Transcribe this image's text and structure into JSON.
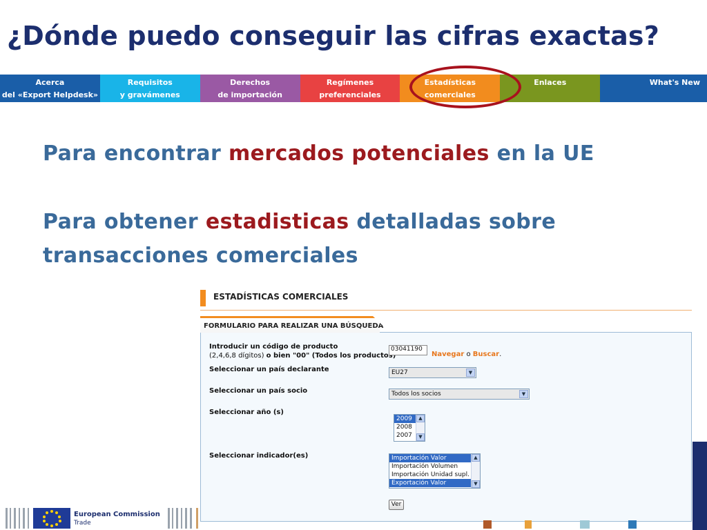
{
  "slide": {
    "title": "¿Dónde puedo conseguir las cifras exactas?",
    "bullet1": {
      "pre": "Para encontrar ",
      "highlight": "mercados potenciales",
      "post": " en la UE"
    },
    "bullet2": {
      "pre": "Para obtener ",
      "highlight": "estadisticas",
      "post": " detalladas sobre"
    },
    "bullet3": {
      "text": "transacciones comerciales"
    }
  },
  "nav": {
    "items": [
      {
        "line1": "Acerca",
        "line2": "del «Export Helpdesk»",
        "color": "#1a5ea8"
      },
      {
        "line1": "Requisitos",
        "line2": "y gravámenes",
        "color": "#19b4e8"
      },
      {
        "line1": "Derechos",
        "line2": "de importación",
        "color": "#9a59a4"
      },
      {
        "line1": "Regímenes",
        "line2": "preferenciales",
        "color": "#e84242"
      },
      {
        "line1": "Estadísticas",
        "line2": "comerciales",
        "color": "#f28c1e"
      },
      {
        "line1": "Enlaces",
        "line2": "",
        "color": "#7a961f"
      },
      {
        "line1": "What's New",
        "line2": "",
        "color": "#1a5ea8"
      }
    ],
    "highlighted_color": "#a8121d"
  },
  "form": {
    "section_title": "ESTADÍSTICAS COMERCIALES",
    "tab_label": "FORMULARIO PARA REALIZAR UNA BÚSQUEDA",
    "product_label_line1": "Introducir un código de producto",
    "product_label_line2_pre": "(2,4,6,8 dígitos) ",
    "product_label_line2_bold": "o bien \"00\" (Todos los productos)",
    "product_code_value": "03041190",
    "navigate_link": "Navegar",
    "or_text": " o ",
    "search_link": "Buscar",
    "period": ".",
    "country_label": "Seleccionar un país declarante",
    "country_value": "EU27",
    "partner_label": "Seleccionar un país socio",
    "partner_value": "Todos los socios",
    "year_label": "Seleccionar año (s)",
    "year_options": [
      "2009",
      "2008",
      "2007"
    ],
    "year_selected": "2009",
    "indicator_label": "Seleccionar indicador(es)",
    "indicator_options": [
      "Importación Valor",
      "Importación Volumen",
      "Importación Unidad supl.",
      "Exportación Valor"
    ],
    "indicator_selected": [
      "Importación Valor",
      "Exportación Valor"
    ],
    "submit_label": "Ver",
    "accent_color": "#f28c1e"
  },
  "footer": {
    "brand_line1": "European Commission",
    "brand_line2": "Trade"
  }
}
